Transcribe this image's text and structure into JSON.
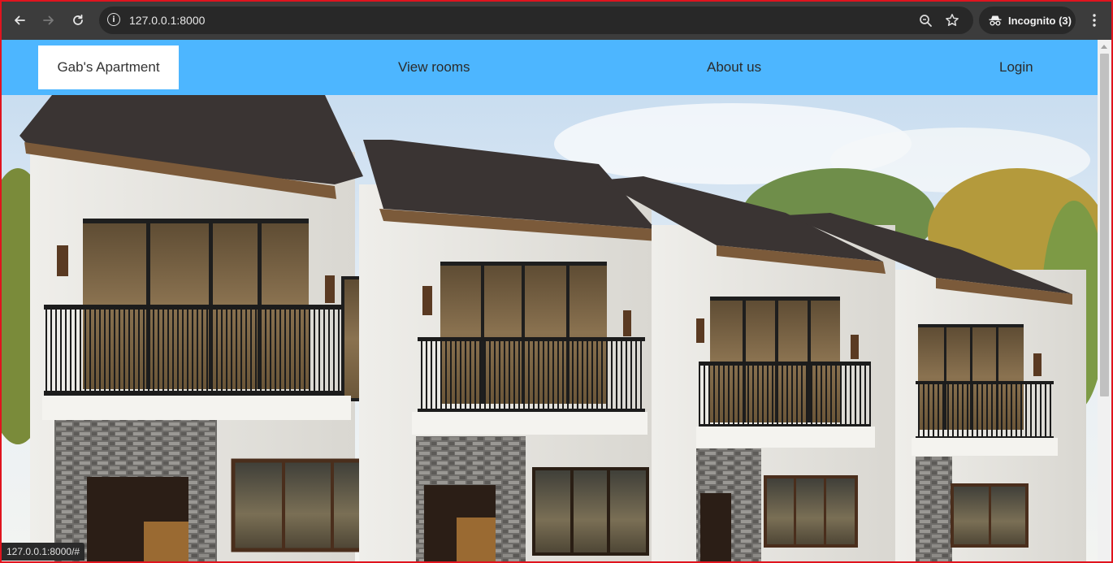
{
  "browser": {
    "url": "127.0.0.1:8000",
    "incognito_label": "Incognito (3)",
    "status_url": "127.0.0.1:8000/#",
    "icons": {
      "back": "back-arrow-icon",
      "forward": "forward-arrow-icon",
      "reload": "reload-icon",
      "site_info": "info-icon",
      "zoom": "zoom-icon",
      "bookmark": "star-icon",
      "incognito": "incognito-icon",
      "menu": "kebab-menu-icon"
    }
  },
  "site": {
    "brand": "Gab's Apartment",
    "nav": {
      "view_rooms": "View rooms",
      "about_us": "About us",
      "login": "Login"
    },
    "colors": {
      "navbar": "#4db6ff",
      "brand_bg": "#ffffff"
    }
  }
}
